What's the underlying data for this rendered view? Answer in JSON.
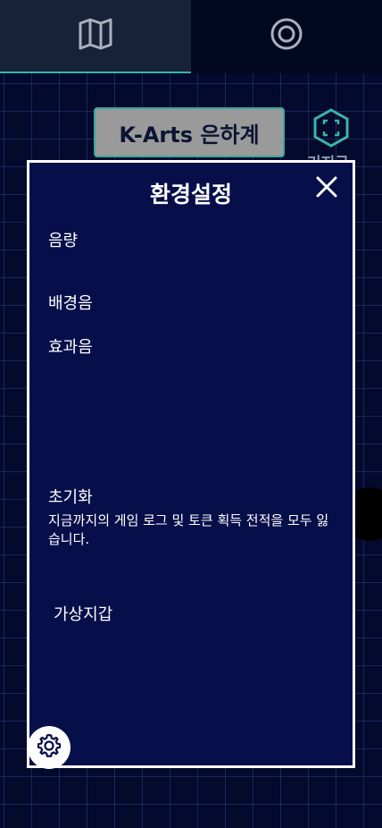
{
  "nav": {
    "tabs": [
      {
        "icon": "map-icon",
        "active": true
      },
      {
        "icon": "target-icon",
        "active": false
      }
    ]
  },
  "background": {
    "brand_button_label": "K-Arts 은하계",
    "side_button_label": "기지국",
    "side_button_icon": "focus-hexagon-icon"
  },
  "settings": {
    "title": "환경설정",
    "volume_label": "음량",
    "bgm_label": "배경음",
    "sfx_label": "효과음",
    "reset_label": "초기화",
    "reset_description": "지금까지의 게임 로그 및 토큰 획득 전적을 모두 잃습니다.",
    "wallet_label": "가상지갑",
    "close_icon": "close-icon",
    "gear_icon": "gear-icon"
  },
  "colors": {
    "background": "#030a2e",
    "modal": "#070f4a",
    "accent": "#3bb3a6"
  }
}
